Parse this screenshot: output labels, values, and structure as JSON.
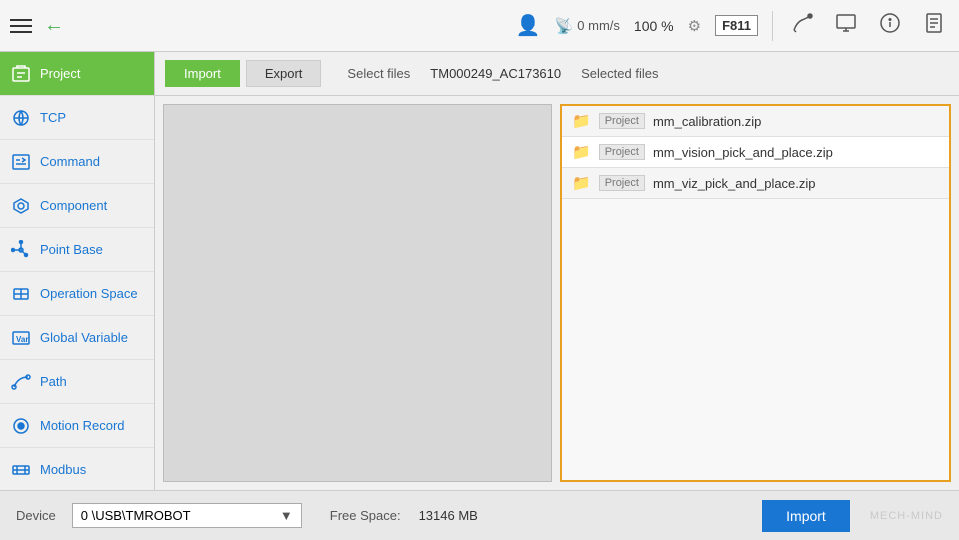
{
  "topbar": {
    "speed_label": "0 mm/s",
    "percent_label": "100 %",
    "frame_badge": "F811",
    "speed_icon": "🚀"
  },
  "tabs": {
    "import_label": "Import",
    "export_label": "Export",
    "select_files_label": "Select files",
    "device_id": "TM000249_AC173610",
    "selected_files_label": "Selected files"
  },
  "sidebar": {
    "items": [
      {
        "id": "project",
        "label": "Project",
        "active": true
      },
      {
        "id": "tcp",
        "label": "TCP",
        "active": false
      },
      {
        "id": "command",
        "label": "Command",
        "active": false
      },
      {
        "id": "component",
        "label": "Component",
        "active": false
      },
      {
        "id": "point-base",
        "label": "Point Base",
        "active": false
      },
      {
        "id": "operation-space",
        "label": "Operation Space",
        "active": false
      },
      {
        "id": "global-variable",
        "label": "Global Variable",
        "active": false
      },
      {
        "id": "path",
        "label": "Path",
        "active": false
      },
      {
        "id": "motion-record",
        "label": "Motion Record",
        "active": false
      },
      {
        "id": "modbus",
        "label": "Modbus",
        "active": false
      }
    ]
  },
  "selected_files": [
    {
      "type": "Project",
      "name": "mm_calibration.zip"
    },
    {
      "type": "Project",
      "name": "mm_vision_pick_and_place.zip"
    },
    {
      "type": "Project",
      "name": "mm_viz_pick_and_place.zip"
    }
  ],
  "bottom": {
    "device_label": "Device",
    "device_value": "0      \\USB\\TMROBOT",
    "free_space_label": "Free Space:",
    "free_space_value": "13146 MB",
    "import_btn": "Import"
  }
}
